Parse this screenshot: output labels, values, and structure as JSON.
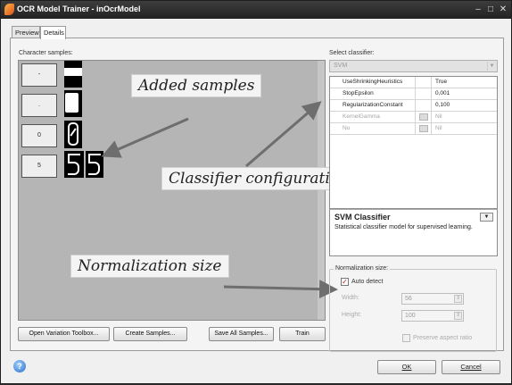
{
  "window": {
    "title": "OCR Model Trainer - inOcrModel",
    "minimize_glyph": "–",
    "maximize_glyph": "□",
    "close_glyph": "✕",
    "app_icon": "flame-icon"
  },
  "tabs": [
    {
      "label": "Preview",
      "active": false
    },
    {
      "label": "Details",
      "active": true
    }
  ],
  "samples": {
    "label": "Character samples:",
    "items": [
      {
        "char": "-"
      },
      {
        "char": "."
      },
      {
        "char": "0"
      },
      {
        "char": "5"
      }
    ]
  },
  "callouts": {
    "added_samples": "Added samples",
    "classifier_configuration": "Classifier configuration",
    "normalization_size": "Normalization size"
  },
  "left_buttons": {
    "open_variation": "Open Variation Toolbox...",
    "create_samples": "Create Samples...",
    "save_all": "Save All Samples...",
    "train": "Train"
  },
  "classifier": {
    "label": "Select classifier:",
    "selected": "SVM",
    "properties": [
      {
        "name": "UseShrinkingHeuristics",
        "value": "True",
        "enabled": true,
        "has_button": false
      },
      {
        "name": "StopEpsilon",
        "value": "0,001",
        "enabled": true,
        "has_button": false
      },
      {
        "name": "RegularizationConstant",
        "value": "0,100",
        "enabled": true,
        "has_button": false
      },
      {
        "name": "KernelGamma",
        "value": "Nil",
        "enabled": false,
        "has_button": true
      },
      {
        "name": "Nu",
        "value": "Nil",
        "enabled": false,
        "has_button": true
      }
    ],
    "description_title": "SVM Classifier",
    "description_text": "Statistical classifier model for supervised learning."
  },
  "normalization": {
    "group_label": "Normalization size:",
    "auto_detect_label": "Auto detect",
    "auto_detect_checked": true,
    "width_label": "Width:",
    "width_value": "56",
    "height_label": "Height:",
    "height_value": "100",
    "preserve_label": "Preserve aspect ratio",
    "preserve_checked": false
  },
  "dialog_buttons": {
    "ok": "OK",
    "cancel": "Cancel"
  },
  "help_glyph": "?",
  "colors": {
    "titlebar": "#2a2a2a",
    "samples_bg": "#b5b5b5",
    "arrow": "#6e6e6e"
  }
}
